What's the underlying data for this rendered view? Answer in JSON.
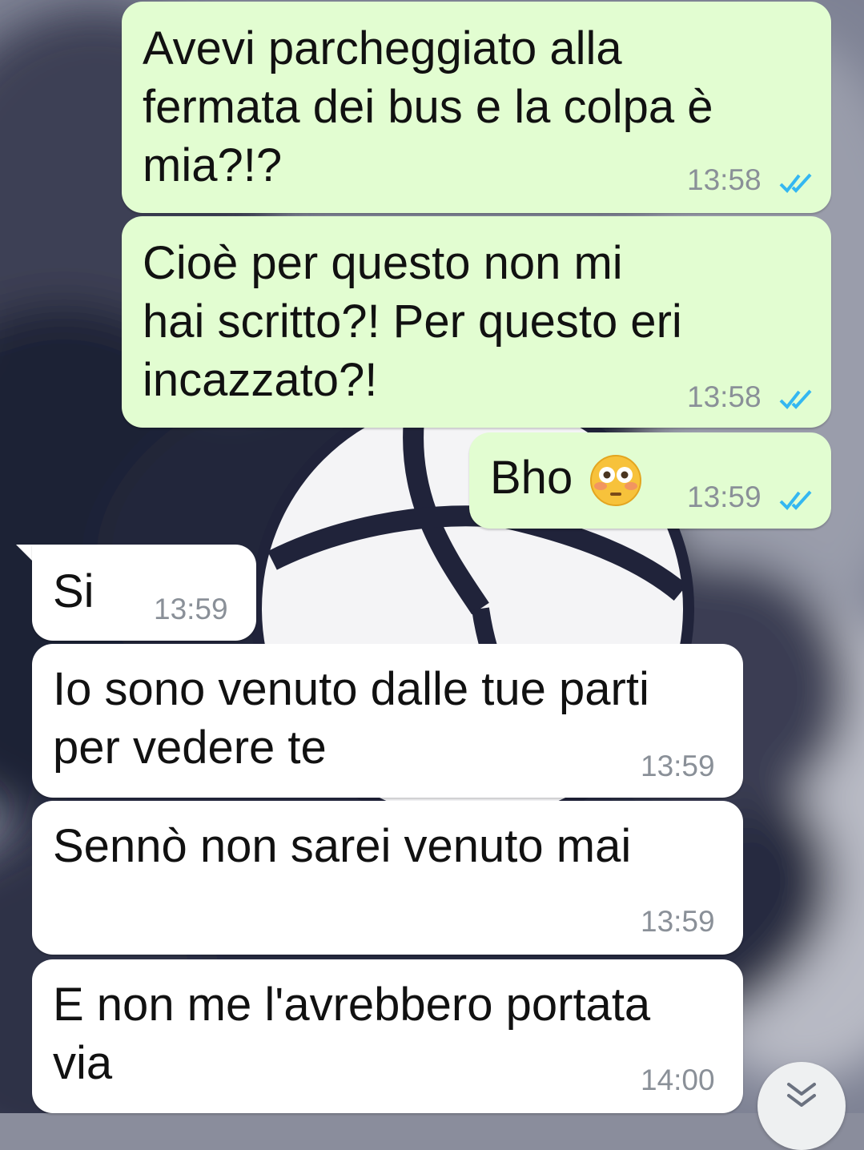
{
  "messages": [
    {
      "text": "Avevi parcheggiato alla\nfermata dei bus e la colpa è\nmia?!?",
      "time": "13:58"
    },
    {
      "text": "Cioè per questo non mi\nhai scritto?! Per questo eri\nincazzato?!",
      "time": "13:58"
    },
    {
      "text": "Bho",
      "emoji": "flushed-face-emoji",
      "time": "13:59"
    },
    {
      "text": "Si",
      "time": "13:59"
    },
    {
      "text": "Io sono venuto dalle tue parti\nper vedere te",
      "time": "13:59"
    },
    {
      "text": "Sennò non sarei venuto mai",
      "time": "13:59"
    },
    {
      "text": "E non me l'avrebbero portata\nvia",
      "time": "14:00"
    }
  ],
  "colors": {
    "outgoing_bubble": "#e2fdd1",
    "incoming_bubble": "#ffffff",
    "read_ticks": "#34b7f1",
    "timestamp": "#8a9098"
  },
  "icons": {
    "read_receipt": "double-check-icon",
    "scroll_down": "double-chevron-down-icon"
  }
}
